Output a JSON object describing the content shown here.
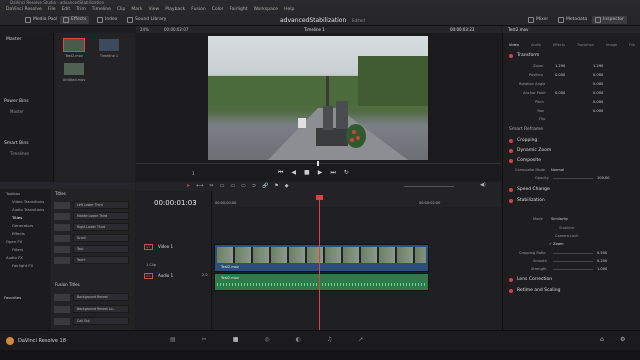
{
  "window": {
    "title": "DaVinci Resolve Studio - advancedStabilization"
  },
  "menu": [
    "DaVinci Resolve",
    "File",
    "Edit",
    "Trim",
    "Timeline",
    "Clip",
    "Mark",
    "View",
    "Playback",
    "Fusion",
    "Color",
    "Fairlight",
    "Workspace",
    "Help"
  ],
  "toolbar": {
    "media_pool": "Media Pool",
    "effects": "Effects",
    "index": "Index",
    "sound_library": "Sound Library",
    "project": "advancedStabilization",
    "status": "Edited",
    "mixer": "Mixer",
    "metadata": "Metadata",
    "inspector": "Inspector"
  },
  "viewer": {
    "zoom": "24%",
    "timecode_left": "00:00:02:07",
    "timeline_name": "Timeline 1",
    "timecode_right": "00:00:03:23",
    "page": "1"
  },
  "media_pool": {
    "master": "Master",
    "clips": [
      {
        "name": "Test2.mov"
      },
      {
        "name": "Timeline 1"
      },
      {
        "name": "Untitled.mov"
      }
    ],
    "power_bins": "Power Bins",
    "power_bins_master": "Master",
    "smart_bins": "Smart Bins",
    "smart_bins_item": "Timelines"
  },
  "inspector": {
    "clip_name": "Test2.mov",
    "tabs": [
      "Video",
      "Audio",
      "Effects",
      "Transition",
      "Image",
      "File"
    ],
    "transform": "Transform",
    "params": [
      {
        "label": "Zoom",
        "x": "1.290",
        "y": "1.290"
      },
      {
        "label": "Position",
        "x": "0.000",
        "y": "0.000"
      },
      {
        "label": "Rotation Angle",
        "x": "0.000"
      },
      {
        "label": "Anchor Point",
        "x": "0.000",
        "y": "0.000"
      },
      {
        "label": "Pitch",
        "x": "0.000"
      },
      {
        "label": "Yaw",
        "x": "0.000"
      },
      {
        "label": "Flip"
      }
    ],
    "smart_reframe": "Smart Reframe",
    "cropping": "Cropping",
    "dynamic_zoom": "Dynamic Zoom",
    "composite": "Composite",
    "composite_mode_label": "Composite Mode",
    "composite_mode": "Normal",
    "opacity_label": "Opacity",
    "opacity": "100.00",
    "speed_change": "Speed Change",
    "stabilization": "Stabilization",
    "mode_label": "Mode",
    "mode": "Similarity",
    "stabilize_btn": "Stabilize",
    "camera_lock": "Camera Lock",
    "zoom_chk": "Zoom",
    "cropping_ratio_label": "Cropping Ratio",
    "cropping_ratio": "0.500",
    "smooth_label": "Smooth",
    "smooth": "0.250",
    "strength_label": "Strength",
    "strength": "1.000",
    "lens_correction": "Lens Correction",
    "retime_scaling": "Retime and Scaling"
  },
  "effects": {
    "tree": [
      "Toolbox",
      "Video Transitions",
      "Audio Transitions",
      "Titles",
      "Generators",
      "Effects",
      "Open FX",
      "Filters",
      "Audio FX",
      "Fairlight FX"
    ],
    "favorites": "Favorites",
    "titles_hdr": "Titles",
    "titles": [
      "Left Lower Third",
      "Middle Lower Third",
      "Right Lower Third",
      "Scroll",
      "Text",
      "Text+"
    ],
    "fusion_titles_hdr": "Fusion Titles",
    "fusion_titles": [
      "Background Reveal",
      "Background Reveal Lo...",
      "Call Out"
    ]
  },
  "timeline": {
    "timecode": "00:00:01:03",
    "ruler": [
      "00:00:00:00",
      "00:00:02:00"
    ],
    "video_track": "Video 1",
    "video_track_id": "V1",
    "video_clip_count": "1 Clip",
    "audio_track": "Audio 1",
    "audio_track_id": "A1",
    "audio_level": "2.0",
    "clip_name": "Test2.mov"
  },
  "bottom": {
    "app": "DaVinci Resolve 18"
  },
  "colors": {
    "accent": "#d34a4a",
    "video_clip": "#2c4f7a",
    "audio_clip": "#2d7a4b",
    "playhead": "#e04040"
  }
}
